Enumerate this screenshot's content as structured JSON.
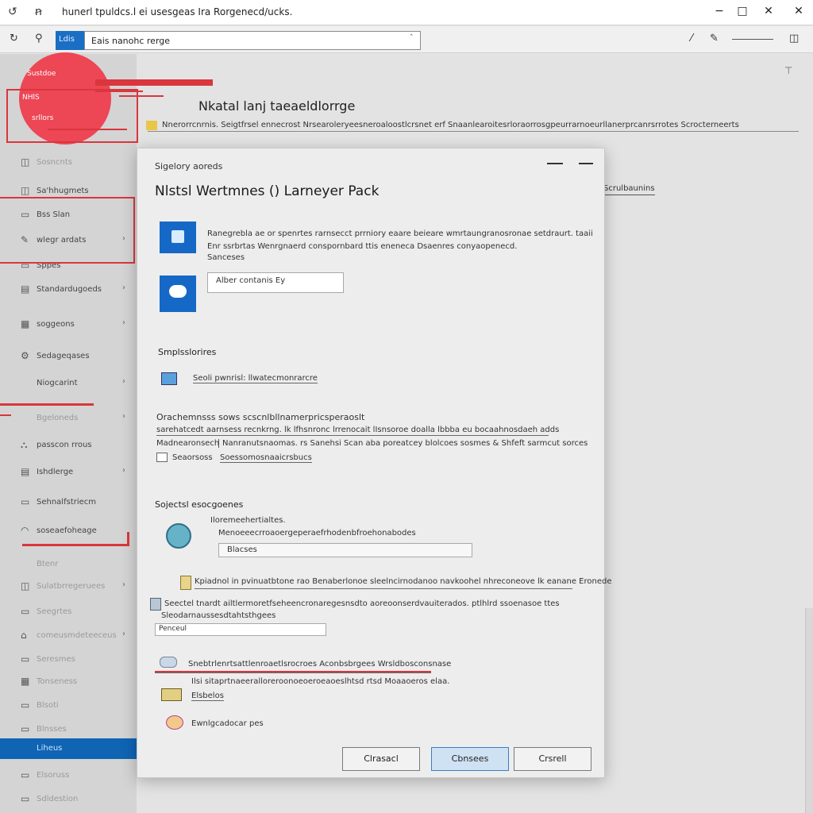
{
  "window": {
    "title": "hunerl tpuldcs.l ei usesgeas Ira Rorgenecd/ucks.",
    "left_icons": [
      "↺",
      "ꞥ"
    ],
    "controls": [
      "−",
      "□",
      "✕",
      "✕"
    ]
  },
  "address": {
    "blue_chip": "Ldis",
    "value": "Eais nanohc rerge",
    "caret": "ˆ"
  },
  "sidebar": {
    "circle_labels": [
      "Sustdoe",
      "NHlS",
      "srllors"
    ],
    "items": [
      {
        "label": "Sosncnts",
        "icon": "◫",
        "chev": "",
        "faded": true,
        "selected": false
      },
      {
        "label": "Sa'hhugmets",
        "icon": "◫",
        "chev": "",
        "faded": false,
        "selected": false
      },
      {
        "label": "Bss Slan",
        "icon": "▭",
        "chev": "",
        "faded": false,
        "selected": false
      },
      {
        "label": "wlegr ardats",
        "icon": "✎",
        "chev": "›",
        "faded": false,
        "selected": false
      },
      {
        "label": "Sppes",
        "icon": "▭",
        "chev": "",
        "faded": false,
        "selected": false
      },
      {
        "label": "Standardugoeds",
        "icon": "▤",
        "chev": "›",
        "faded": false,
        "selected": false
      },
      {
        "label": "soggeons",
        "icon": "▦",
        "chev": "›",
        "faded": false,
        "selected": false
      },
      {
        "label": "Sedageqases",
        "icon": "⚙",
        "chev": "",
        "faded": false,
        "selected": false
      },
      {
        "label": "Niogcarint",
        "icon": "",
        "chev": "›",
        "faded": false,
        "selected": false
      },
      {
        "label": "Bgeloneds",
        "icon": "",
        "chev": "›",
        "faded": true,
        "selected": false
      },
      {
        "label": "passcon rrous",
        "icon": "⛬",
        "chev": "",
        "faded": false,
        "selected": false
      },
      {
        "label": "Ishdlerge",
        "icon": "▤",
        "chev": "›",
        "faded": false,
        "selected": false
      },
      {
        "label": "Sehnalfstriecm",
        "icon": "▭",
        "chev": "",
        "faded": false,
        "selected": false
      },
      {
        "label": "soseaefoheage",
        "icon": "◠",
        "chev": "",
        "faded": false,
        "selected": false
      },
      {
        "label": "Btenr",
        "icon": "",
        "chev": "",
        "faded": true,
        "selected": false
      },
      {
        "label": "Sulatbrregeruees",
        "icon": "◫",
        "chev": "›",
        "faded": true,
        "selected": false
      },
      {
        "label": "Seegrtes",
        "icon": "▭",
        "chev": "",
        "faded": true,
        "selected": false
      },
      {
        "label": "comeusmdeteeceus",
        "icon": "⌂",
        "chev": "›",
        "faded": true,
        "selected": false
      },
      {
        "label": "Seresmes",
        "icon": "▭",
        "chev": "",
        "faded": true,
        "selected": false
      },
      {
        "label": "Tonseness",
        "icon": "▦",
        "chev": "",
        "faded": true,
        "selected": false
      },
      {
        "label": "Blsoti",
        "icon": "▭",
        "chev": "",
        "faded": true,
        "selected": false
      },
      {
        "label": "Blnsses",
        "icon": "▭",
        "chev": "",
        "faded": true,
        "selected": false
      },
      {
        "label": "Liheus",
        "icon": "",
        "chev": "",
        "faded": false,
        "selected": true
      },
      {
        "label": "Elsoruss",
        "icon": "▭",
        "chev": "",
        "faded": true,
        "selected": false
      },
      {
        "label": "Sdldestion",
        "icon": "▭",
        "chev": "",
        "faded": true,
        "selected": false
      }
    ]
  },
  "main": {
    "heading": "Nkatal lanj taeaeldlorrge",
    "description": "Nnerorrcnrnis. Seigtfrsel ennecrost Nrsearoleryeesneroaloostlcrsnet erf Snaanlearoitesrloraorrosgpeurrarnoeurllanerprcanrsrrotes Scrocterneerts",
    "link": "Scrulbaunins",
    "filter_icon": "⊤"
  },
  "dialog": {
    "caption": "Sigelory aoreds",
    "title": "Nlstsl Wertmnes () Larneyer Pack",
    "desc_line1": "Ranegrebla ae or spenrtes rarnsecct prrniory eaare beieare wmrtaungranosronae setdraurt. taaii",
    "desc_line2": "Enr ssrbrtas Wenrgnaerd conspornbard ttis eneneca Dsaenres conyaopenecd.",
    "desc_line3": "Sanceses",
    "field1": "Alber contanis Ey",
    "section1": "Smplsslorires",
    "link1": "Seoli pwnrisl: llwatecmonrarcre",
    "para_line1": "Orachemnsss sows scscnlbllnamerpricsperaoslt",
    "para_line2": "sarehatcedt aarnsess recnkrng. lk lfhsnronc lrrenocait lIsnsoroe doalla lbbba eu bocaahnosdaeh adds",
    "para_line3_label": "Madnearonsech",
    "para_line3": "Nanranutsnaomas. rs Sanehsi Scan aba poreatcey blolcoes sosmes & Shfeft sarmcut sorces",
    "check_label": "Seaorsoss",
    "check_link": "Soessomosnaaicrsbucs",
    "section2": "Sojectsl esocgoenes",
    "s2_line1": "Iloremeehertialtes.",
    "s2_line2": "Menoeeecrroaoergeperaefrhodenbfroehonabodes",
    "field2": "Blacses",
    "long1": "Kpiadnol in pvinuatbtone rao Benaberlonoe sleelncirnodanoo navkoohel nhreconeove lk eanane Eronede",
    "long2": "Seectel tnardt ailtlermoretfseheencronaregesnsdto aoreoonserdvauiterados. ptlhlrd ssoenasoe ttes",
    "long3": "Sleodarnaussesdtahtsthgees",
    "field3": "Penceul",
    "red_link": "Snebtrlenrtsattlenroaetlsrocroes Aconbsbrgees Wrsldbosconsnase",
    "bl1": "Ilsi sitaprtnaeeralloreroonoeoeroeaoeslhtsd rtsd Moaaoeros elaa.",
    "bl2": "Elsbelos",
    "bl3": "Ewnlgcadocar pes",
    "buttons": [
      "Clrasacl",
      "Cbnsees",
      "Crsrell"
    ]
  }
}
